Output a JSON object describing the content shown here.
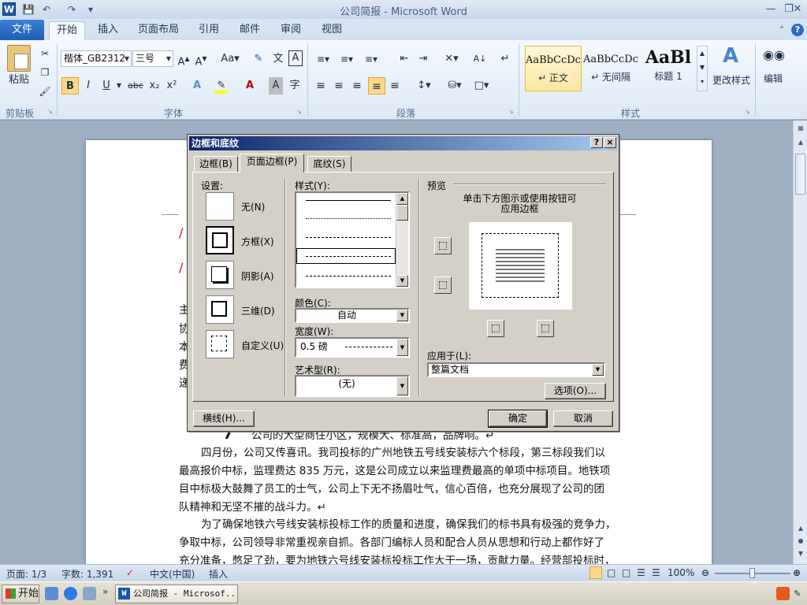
{
  "window": {
    "title": "公司简报  -  Microsoft Word",
    "app_icon": "W"
  },
  "quick_access": [
    "save-icon",
    "undo-icon",
    "redo-icon",
    "customize-icon"
  ],
  "ribbon_tabs": [
    "文件",
    "开始",
    "插入",
    "页面布局",
    "引用",
    "邮件",
    "审阅",
    "视图"
  ],
  "ribbon": {
    "clipboard": {
      "paste": "粘贴",
      "group": "剪贴板"
    },
    "font": {
      "name": "楷体_GB2312",
      "size": "三号",
      "group": "字体",
      "buttons": [
        "B",
        "I",
        "U",
        "abc",
        "x₂",
        "x²",
        "A",
        "A"
      ]
    },
    "paragraph": {
      "group": "段落"
    },
    "styles": {
      "group": "样式",
      "items": [
        {
          "sample": "AaBbCcDc",
          "name": "↵ 正文"
        },
        {
          "sample": "AaBbCcDc",
          "name": "↵ 无间隔"
        },
        {
          "sample": "AaBl",
          "name": "标题 1"
        }
      ],
      "change": "更改样式"
    },
    "editing": {
      "label": "编辑"
    }
  },
  "document": {
    "left_chars": [
      "主",
      "协",
      "本",
      "费",
      "递"
    ],
    "lines": [
      {
        "num": "7",
        "text": "公司的大型商住小区，规模大、标准高，品牌响。↵"
      },
      {
        "text": "四月份，公司又传喜讯。我司投标的广州地铁五号线安装标六个标段，第三标段我们以"
      },
      {
        "text": "最高报价中标，监理费达 835 万元，这是公司成立以来监理费最高的单项中标项目。地铁项"
      },
      {
        "text": "目中标极大鼓舞了员工的士气，公司上下无不扬眉吐气，信心百倍，也充分展现了公司的团"
      },
      {
        "text": "队精神和无坚不摧的战斗力。↵"
      },
      {
        "text": "为了确保地铁六号线安装标投标工作的质量和进度，确保我们的标书具有极强的竞争力，"
      },
      {
        "text": "争取中标，公司领导非常重视亲自抓。各部门编标人员和配合人员从思想和行动上都作好了"
      },
      {
        "text": "充分准备，憋足了劲，要为地铁六号线安装标投标工作大干一场，贡献力量。经营部投标时，"
      }
    ]
  },
  "status": {
    "page": "页面: 1/3",
    "words": "字数: 1,391",
    "language": "中文(中国)",
    "mode": "插入",
    "zoom": "100%"
  },
  "taskbar": {
    "start": "开始",
    "task": "公司简报 - Microsof..."
  },
  "dialog": {
    "title": "边框和底纹",
    "help": "?",
    "close": "×",
    "tabs": [
      "边框(B)",
      "页面边框(P)",
      "底纹(S)"
    ],
    "active_tab": 1,
    "settings_label": "设置:",
    "settings": [
      "无(N)",
      "方框(X)",
      "阴影(A)",
      "三维(D)",
      "自定义(U)"
    ],
    "selected_setting": 1,
    "style_label": "样式(Y):",
    "color_label": "颜色(C):",
    "color_value": "自动",
    "width_label": "宽度(W):",
    "width_value": "0.5 磅",
    "art_label": "艺术型(R):",
    "art_value": "(无)",
    "preview_label": "预览",
    "preview_hint_1": "单击下方图示或使用按钮可",
    "preview_hint_2": "应用边框",
    "apply_label": "应用于(L):",
    "apply_value": "整篇文档",
    "options_btn": "选项(O)...",
    "hline_btn": "横线(H)...",
    "ok_btn": "确定",
    "cancel_btn": "取消"
  }
}
